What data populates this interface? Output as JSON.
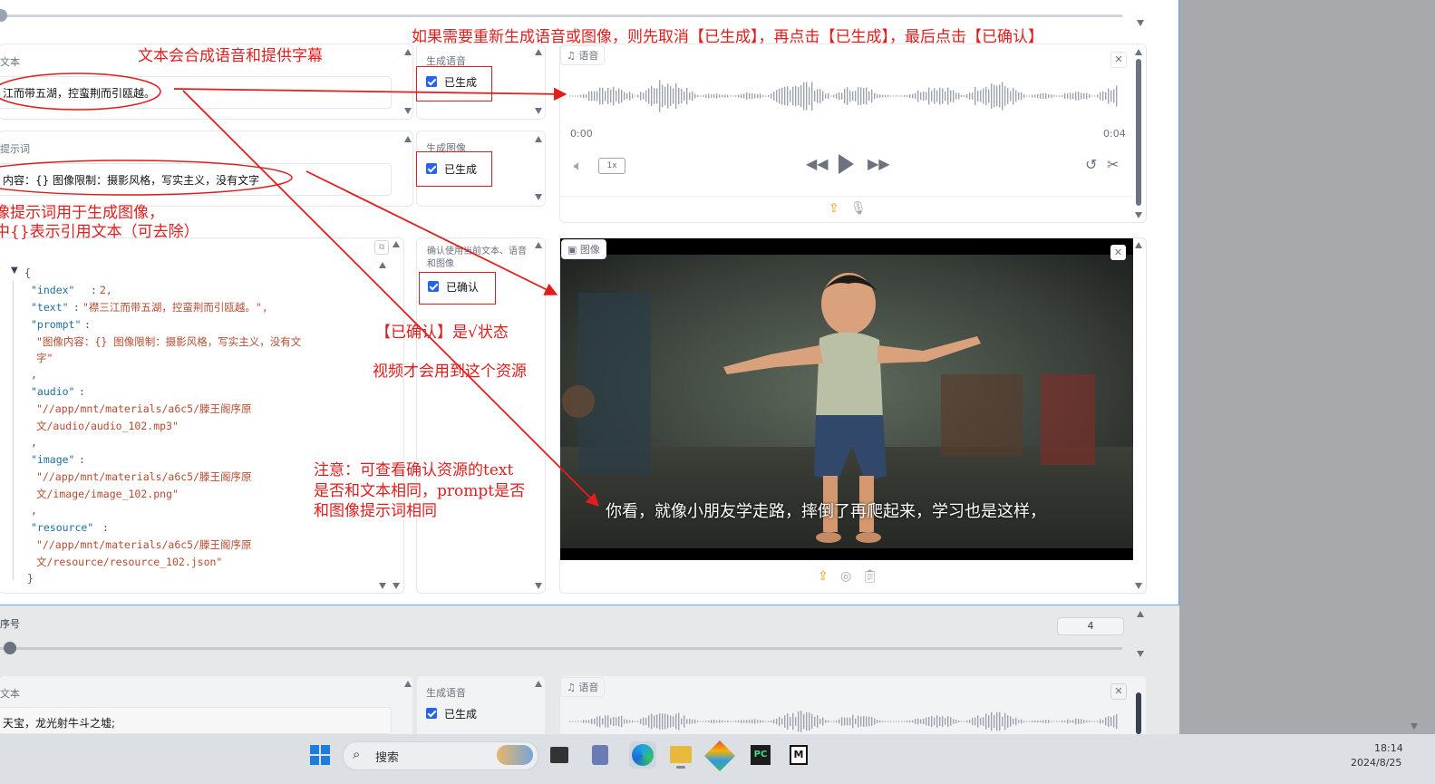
{
  "top": {
    "slider_value": ""
  },
  "block1": {
    "text_label": "文本",
    "text_value": "江而带五湖，控蛮荆而引瓯越。",
    "prompt_label": "提示词",
    "prompt_value": "内容：{} 图像限制：摄影风格，写实主义，没有文字",
    "gen_audio_label": "生成语音",
    "gen_audio_check": "已生成",
    "gen_image_label": "生成图像",
    "gen_image_check": "已生成",
    "confirm_label": "确认使用当前文本、语音和图像",
    "confirm_check": "已确认",
    "audio_label": "语音",
    "audio_start": "0:00",
    "audio_end": "0:04",
    "speed": "1x",
    "image_label": "图像",
    "image_caption": "你看，就像小朋友学走路，摔倒了再爬起来，学习也是这样，",
    "json_lines": {
      "open": "{",
      "index_key": "\"index\"",
      "index_val": "2,",
      "text_key": "\"text\"",
      "text_val": "\"襟三江而带五湖，控蛮荆而引瓯越。\",",
      "prompt_key": "\"prompt\"",
      "prompt_val1": "\"图像内容：{} 图像限制：摄影风格，写实主义，没有文",
      "prompt_val2": "字\"",
      "audio_key": "\"audio\"",
      "audio_val1": "\"//app/mnt/materials/a6c5/滕王阁序原",
      "audio_val2": "文/audio/audio_102.mp3\"",
      "image_key": "\"image\"",
      "image_val1": "\"//app/mnt/materials/a6c5/滕王阁序原",
      "image_val2": "文/image/image_102.png\"",
      "resource_key": "\"resource\"",
      "resource_val1": "\"//app/mnt/materials/a6c5/滕王阁序原",
      "resource_val2": "文/resource/resource_102.json\"",
      "close": "}"
    }
  },
  "block2": {
    "index_label": "序号",
    "index_value": "4",
    "text_label": "文本",
    "text_value": "天宝，龙光射牛斗之墟;",
    "gen_audio_label": "生成语音",
    "gen_audio_check": "已生成",
    "audio_label": "语音"
  },
  "annotations": {
    "a1": "文本会合成语音和提供字幕",
    "a2": "如果需要重新生成语音或图像，则先取消【已生成】，再点击【已生成】，最后点击【已确认】",
    "a3_1": "像提示词用于生成图像，",
    "a3_2": "中{}表示引用文本（可去除）",
    "a4": "【已确认】是√状态",
    "a5": "视频才会用到这个资源",
    "a6_1": "注意：可查看确认资源的text",
    "a6_2": "是否和文本相同，prompt是否",
    "a6_3": "和图像提示词相同"
  },
  "taskbar": {
    "search_placeholder": "搜索",
    "time": "18:14",
    "date": "2024/8/25"
  },
  "colors": {
    "accent": "#2563eb",
    "annotation": "#e11d1d",
    "orange": "#f59e0b"
  }
}
